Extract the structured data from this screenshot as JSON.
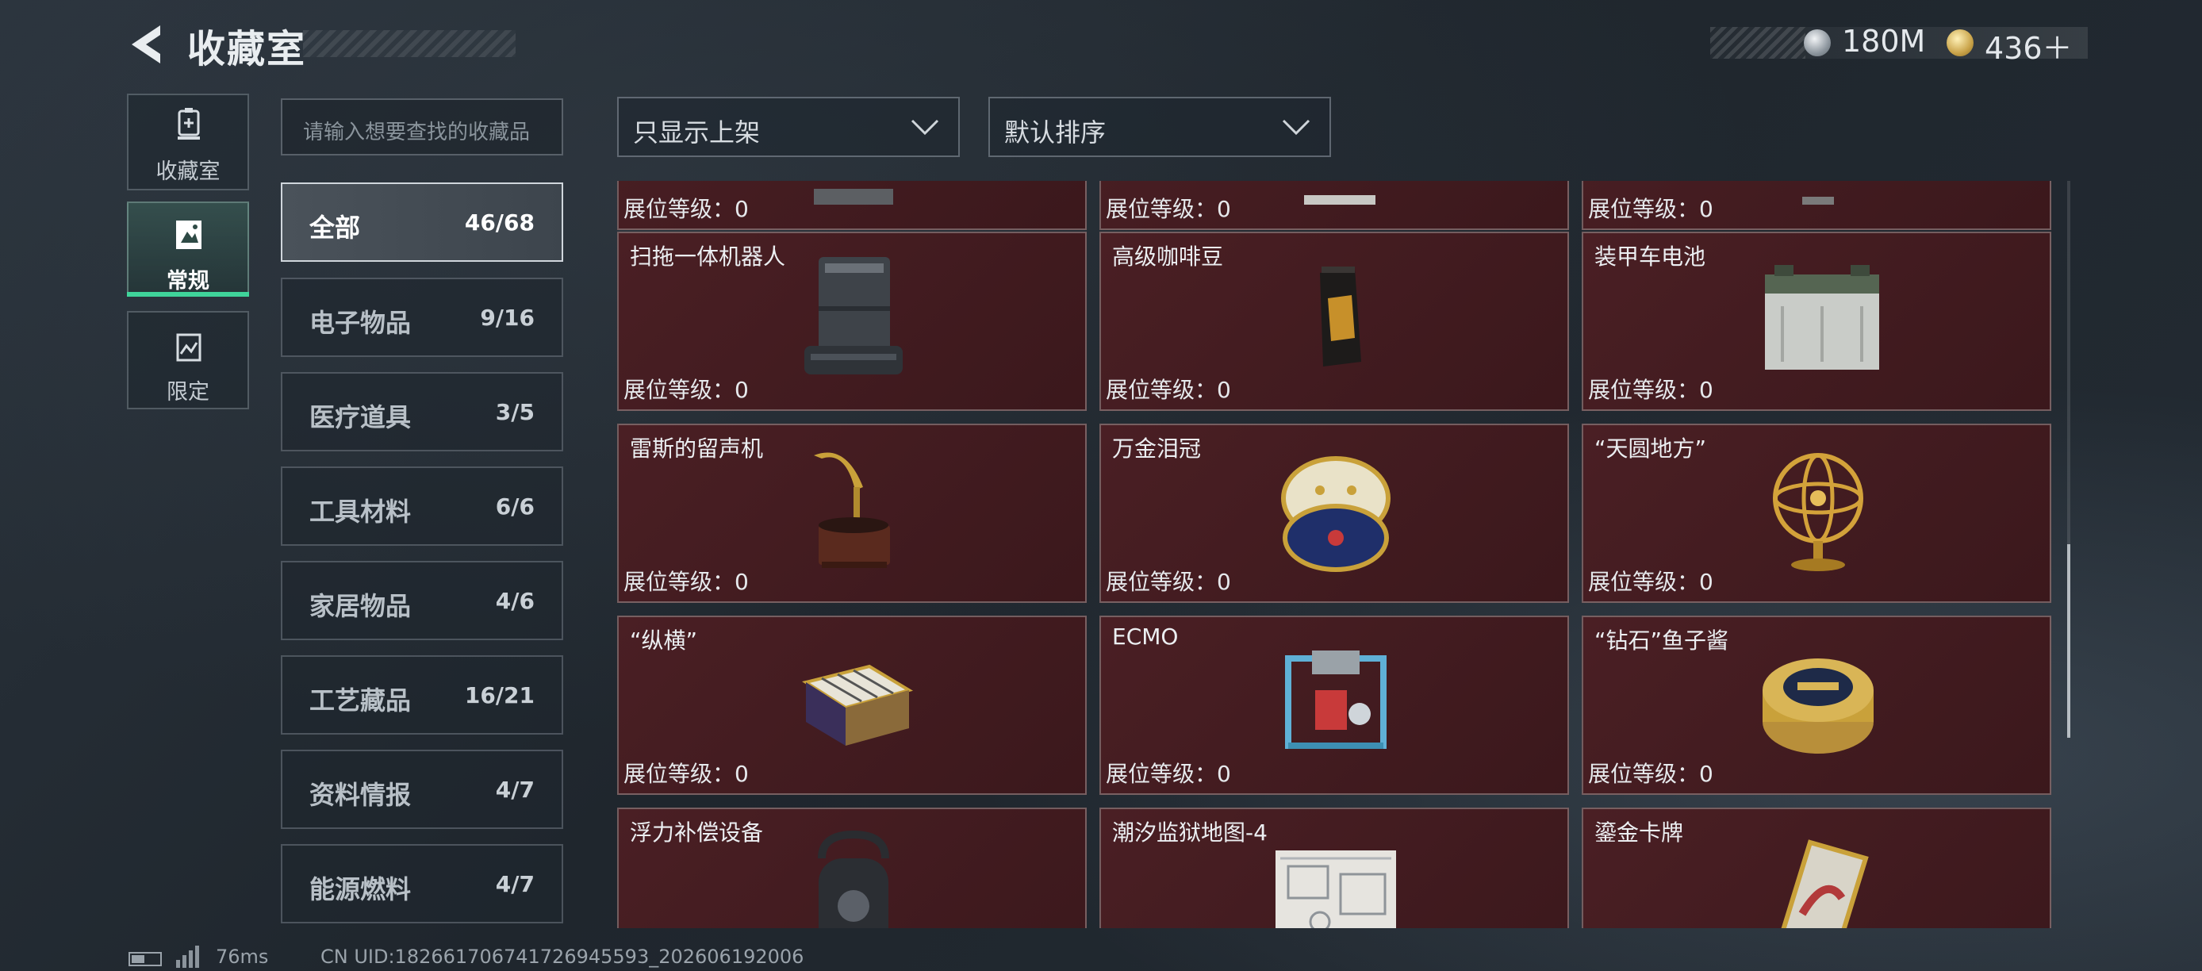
{
  "header": {
    "title": "收藏室",
    "currency": [
      {
        "icon": "silver-coin-icon",
        "value": "180M"
      },
      {
        "icon": "gold-coin-icon",
        "value": "436＋"
      }
    ]
  },
  "side_tabs": [
    {
      "label": "收藏室",
      "icon": "collection-room-icon",
      "active": false
    },
    {
      "label": "常规",
      "icon": "regular-icon",
      "active": true
    },
    {
      "label": "限定",
      "icon": "limited-icon",
      "active": false
    }
  ],
  "search": {
    "placeholder": "请输入想要查找的收藏品"
  },
  "categories": [
    {
      "name": "全部",
      "count": "46/68",
      "active": true
    },
    {
      "name": "电子物品",
      "count": "9/16"
    },
    {
      "name": "医疗道具",
      "count": "3/5"
    },
    {
      "name": "工具材料",
      "count": "6/6"
    },
    {
      "name": "家居物品",
      "count": "4/6"
    },
    {
      "name": "工艺藏品",
      "count": "16/21"
    },
    {
      "name": "资料情报",
      "count": "4/7"
    },
    {
      "name": "能源燃料",
      "count": "4/7"
    }
  ],
  "filters": {
    "display_filter": "只显示上架",
    "sort": "默认排序"
  },
  "items": [
    {
      "name": "",
      "level": "展位等级：0",
      "icon": "item-partial-icon"
    },
    {
      "name": "",
      "level": "展位等级：0",
      "icon": "item-partial-icon"
    },
    {
      "name": "",
      "level": "展位等级：0",
      "icon": "item-partial-icon"
    },
    {
      "name": "扫拖一体机器人",
      "level": "展位等级：0",
      "icon": "robot-vacuum-icon"
    },
    {
      "name": "高级咖啡豆",
      "level": "展位等级：0",
      "icon": "coffee-bag-icon"
    },
    {
      "name": "装甲车电池",
      "level": "展位等级：0",
      "icon": "battery-icon"
    },
    {
      "name": "雷斯的留声机",
      "level": "展位等级：0",
      "icon": "gramophone-icon"
    },
    {
      "name": "万金泪冠",
      "level": "展位等级：0",
      "icon": "jeweled-egg-icon"
    },
    {
      "name": "“天圆地方”",
      "level": "展位等级：0",
      "icon": "armillary-sphere-icon"
    },
    {
      "name": "“纵横”",
      "level": "展位等级：0",
      "icon": "chess-box-icon"
    },
    {
      "name": "ECMO",
      "level": "展位等级：0",
      "icon": "ecmo-machine-icon"
    },
    {
      "name": "“钻石”鱼子酱",
      "level": "展位等级：0",
      "icon": "caviar-tin-icon"
    },
    {
      "name": "浮力补偿设备",
      "level": "",
      "icon": "buoyancy-device-icon"
    },
    {
      "name": "潮汐监狱地图-4",
      "level": "",
      "icon": "prison-map-icon"
    },
    {
      "name": "鎏金卡牌",
      "level": "",
      "icon": "gilded-card-icon"
    }
  ],
  "status": {
    "ping": "76ms",
    "uid": "CN UID:1826617067417269455​93_202606192006"
  }
}
